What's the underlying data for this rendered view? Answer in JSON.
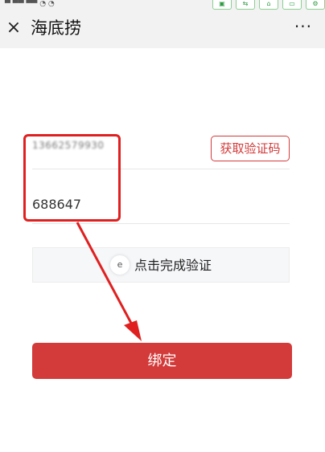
{
  "status_bar": {
    "left_text": "▀ ▀▀ ▀▀ ◔ ◔",
    "icons": [
      "▣",
      "⇆",
      "⌂",
      "▭",
      "⚙"
    ]
  },
  "nav": {
    "close_glyph": "×",
    "title": "海底捞",
    "more_glyph": "···"
  },
  "form": {
    "phone_value": "13662579930",
    "get_code_label": "获取验证码",
    "code_value": "688647",
    "verify_icon": "e",
    "verify_label": "点击完成验证"
  },
  "bind_button_label": "绑定",
  "colors": {
    "accent": "#d33a3a",
    "annotation": "#e02020"
  }
}
